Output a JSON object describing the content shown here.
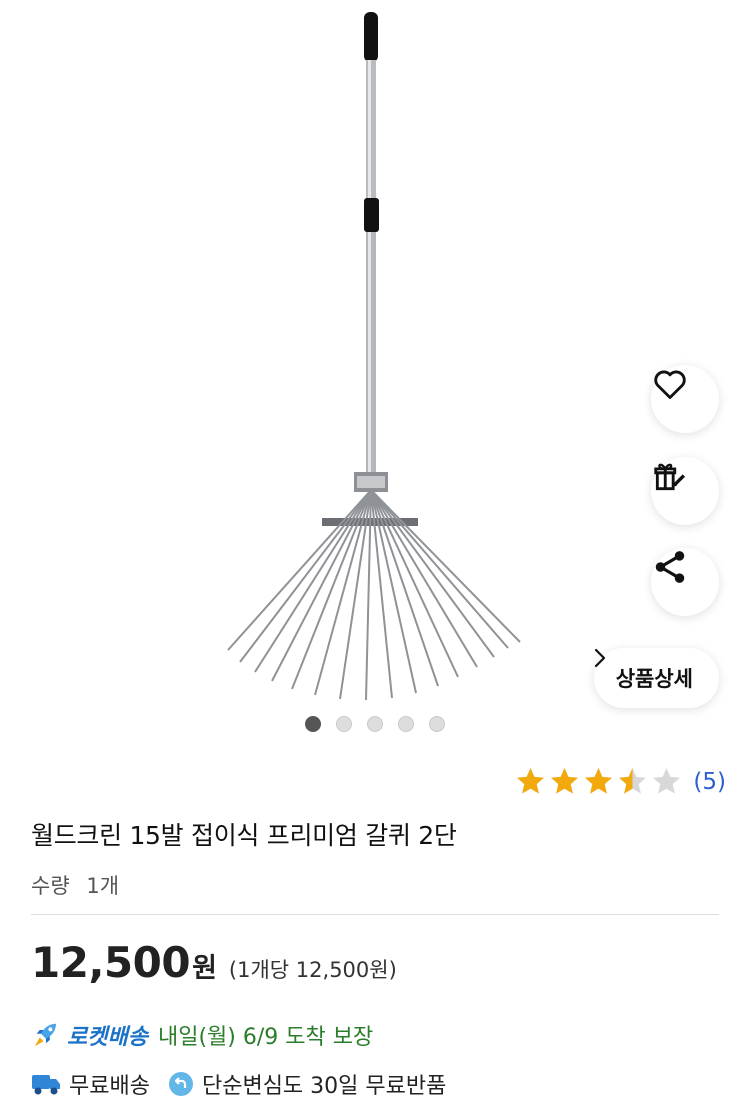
{
  "gallery": {
    "image_alt": "folding rake",
    "dot_count": 5,
    "active_index": 0
  },
  "actions": {
    "wishlist_icon": "heart-outline-icon",
    "gift_icon": "gift-rocket-icon",
    "share_icon": "share-icon",
    "detail_label": "상품상세"
  },
  "rating": {
    "stars": 3.5,
    "max": 5,
    "count_text": "(5)",
    "star_color": "#f2a90b",
    "empty_color": "#d8d8d8"
  },
  "product": {
    "title": "월드크린 15발 접이식 프리미엄 갈퀴 2단",
    "quantity_label": "수량",
    "quantity_value": "1개"
  },
  "price": {
    "amount": "12,500",
    "currency": "원",
    "per_unit": "(1개당 12,500원)"
  },
  "delivery": {
    "rocket_label": "로켓배송",
    "arrival_text": "내일(월) 6/9 도착 보장"
  },
  "benefits": {
    "free_shipping": "무료배송",
    "free_return": "단순변심도 30일 무료반품"
  },
  "colors": {
    "rocket_blue": "#1a73c9",
    "arrival_green": "#2b7d2b",
    "link_blue": "#2f5fd0"
  }
}
